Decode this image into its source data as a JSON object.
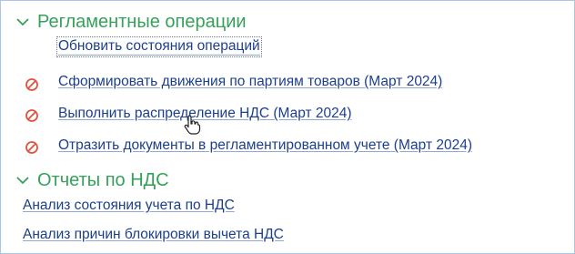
{
  "colors": {
    "section_title": "#36a15a",
    "link": "#1c3f8c",
    "error_icon": "#e0533f",
    "frame_border": "#a9c6e2"
  },
  "sections": [
    {
      "title": "Регламентные операции",
      "icon": "chevron-down-icon",
      "items": [
        {
          "label": "Обновить состояния операций",
          "status_icon": null
        },
        {
          "label": "Сформировать движения по партиям товаров (Март 2024)",
          "status_icon": "error-prohibited-icon"
        },
        {
          "label": "Выполнить распределение НДС (Март 2024)",
          "status_icon": "error-prohibited-icon"
        },
        {
          "label": "Отразить документы в регламентированном учете (Март 2024)",
          "status_icon": "error-prohibited-icon"
        }
      ]
    },
    {
      "title": "Отчеты по НДС",
      "icon": "chevron-down-icon",
      "items": [
        {
          "label": "Анализ состояния учета по НДС"
        },
        {
          "label": "Анализ причин блокировки вычета НДС"
        }
      ]
    }
  ],
  "cursor": "hand-pointer-icon"
}
